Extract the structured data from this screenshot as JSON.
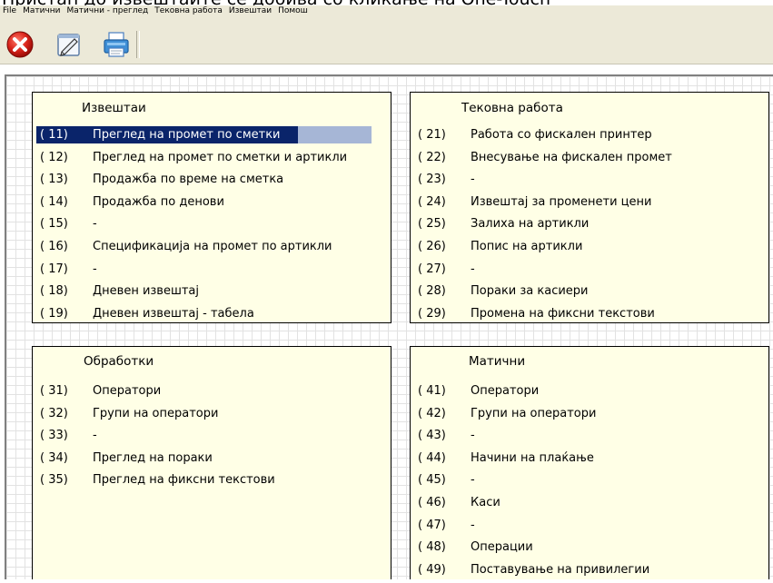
{
  "caption": "Пристап до извештаите се добива со кликање на One-Touch",
  "menu": [
    "File",
    "Матични",
    "Матични - преглед",
    "Тековна работа",
    "Извештаи",
    "Помош"
  ],
  "toolbar_icons": [
    "close-icon",
    "edit-note-icon",
    "printer-icon"
  ],
  "panels": {
    "reports": {
      "title": "Извештаи",
      "items": [
        {
          "num": "( 11)",
          "label": "Преглед на промет по сметки"
        },
        {
          "num": "( 12)",
          "label": "Преглед на промет по сметки и артикли"
        },
        {
          "num": "( 13)",
          "label": "Продажба по време на сметка"
        },
        {
          "num": "( 14)",
          "label": "Продажба по денови"
        },
        {
          "num": "( 15)",
          "label": "-"
        },
        {
          "num": "( 16)",
          "label": "Спецификација на промет по артикли"
        },
        {
          "num": "( 17)",
          "label": "-"
        },
        {
          "num": "( 18)",
          "label": "Дневен извештај"
        },
        {
          "num": "( 19)",
          "label": "Дневен извештај - табела"
        }
      ]
    },
    "current_work": {
      "title": "Тековна работа",
      "items": [
        {
          "num": "( 21)",
          "label": "Работа со фискален принтер"
        },
        {
          "num": "( 22)",
          "label": "Внесување на фискален промет"
        },
        {
          "num": "( 23)",
          "label": "-"
        },
        {
          "num": "( 24)",
          "label": "Извештај за променети цени"
        },
        {
          "num": "( 25)",
          "label": "Залиха на артикли"
        },
        {
          "num": "( 26)",
          "label": "Попис на артикли"
        },
        {
          "num": "( 27)",
          "label": "-"
        },
        {
          "num": "( 28)",
          "label": "Пораки за касиери"
        },
        {
          "num": "( 29)",
          "label": "Промена на фиксни текстови"
        }
      ]
    },
    "processing": {
      "title": "Обработки",
      "items": [
        {
          "num": "( 31)",
          "label": "Оператори"
        },
        {
          "num": "( 32)",
          "label": "Групи на оператори"
        },
        {
          "num": "( 33)",
          "label": "-"
        },
        {
          "num": "( 34)",
          "label": "Преглед на пораки"
        },
        {
          "num": "( 35)",
          "label": "Преглед на фиксни текстови"
        }
      ]
    },
    "master": {
      "title": "Матични",
      "items": [
        {
          "num": "( 41)",
          "label": "Оператори"
        },
        {
          "num": "( 42)",
          "label": "Групи на оператори"
        },
        {
          "num": "( 43)",
          "label": "-"
        },
        {
          "num": "( 44)",
          "label": "Начини на плаќање"
        },
        {
          "num": "( 45)",
          "label": "-"
        },
        {
          "num": "( 46)",
          "label": "Каси"
        },
        {
          "num": "( 47)",
          "label": "-"
        },
        {
          "num": "( 48)",
          "label": "Операции"
        },
        {
          "num": "( 49)",
          "label": "Поставување на привилегии"
        }
      ]
    }
  },
  "selected_item": "( 11)"
}
